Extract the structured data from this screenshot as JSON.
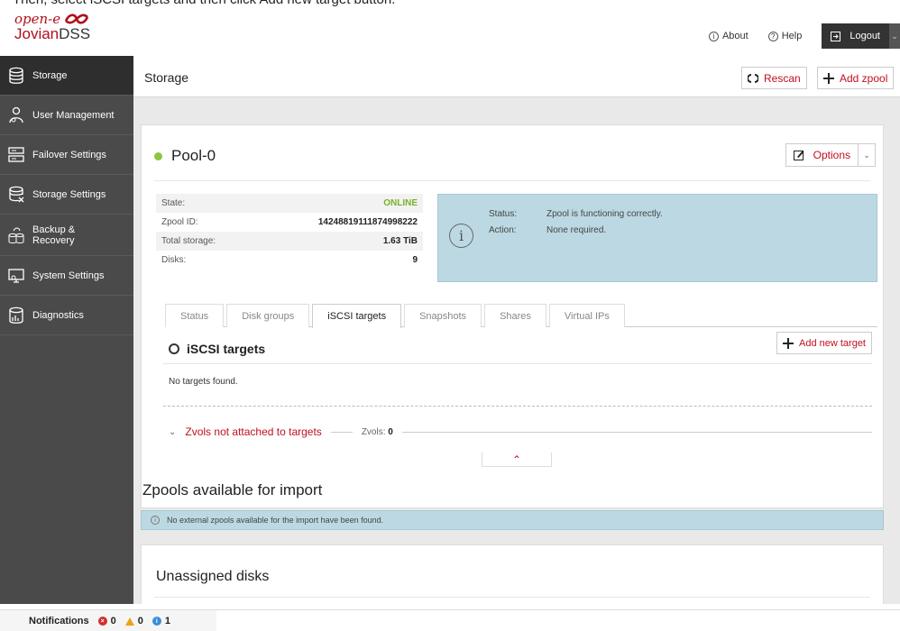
{
  "top_strip": {
    "text": "Then, select iSCSI targets and then click Add new target button."
  },
  "header": {
    "logo_top": "open-e",
    "logo_brand": "Jovian",
    "logo_suffix": "DSS",
    "about_label": "About",
    "help_label": "Help",
    "logout_label": "Logout"
  },
  "sidebar": {
    "items": [
      {
        "label": "Storage"
      },
      {
        "label": "User Management"
      },
      {
        "label": "Failover Settings"
      },
      {
        "label": "Storage Settings"
      },
      {
        "label": "Backup & Recovery"
      },
      {
        "label": "System Settings"
      },
      {
        "label": "Diagnostics"
      }
    ]
  },
  "main": {
    "title": "Storage",
    "rescan_label": "Rescan",
    "add_zpool_label": "Add zpool"
  },
  "pool": {
    "name": "Pool-0",
    "status_color": "#8dc63f",
    "options_label": "Options",
    "info": [
      {
        "key": "State:",
        "value": "ONLINE"
      },
      {
        "key": "Zpool ID:",
        "value": "14248819111874998222"
      },
      {
        "key": "Total storage:",
        "value": "1.63 TiB"
      },
      {
        "key": "Disks:",
        "value": "9"
      }
    ],
    "status": {
      "status_key": "Status:",
      "status_value": "Zpool is functioning correctly.",
      "action_key": "Action:",
      "action_value": "None required."
    },
    "tabs": [
      "Status",
      "Disk groups",
      "iSCSI targets",
      "Snapshots",
      "Shares",
      "Virtual IPs"
    ],
    "active_tab": "iSCSI targets"
  },
  "iscsi": {
    "title": "iSCSI targets",
    "add_label": "Add new target",
    "empty_text": "No targets found.",
    "zvols_link": "Zvols not attached to targets",
    "zvols_label": "Zvols:",
    "zvols_count": "0"
  },
  "import": {
    "title": "Zpools available for import",
    "note": "No external zpools available for the import have been found."
  },
  "unassigned": {
    "title": "Unassigned disks"
  },
  "notifications": {
    "label": "Notifications",
    "errors": "0",
    "warnings": "0",
    "info": "1"
  }
}
